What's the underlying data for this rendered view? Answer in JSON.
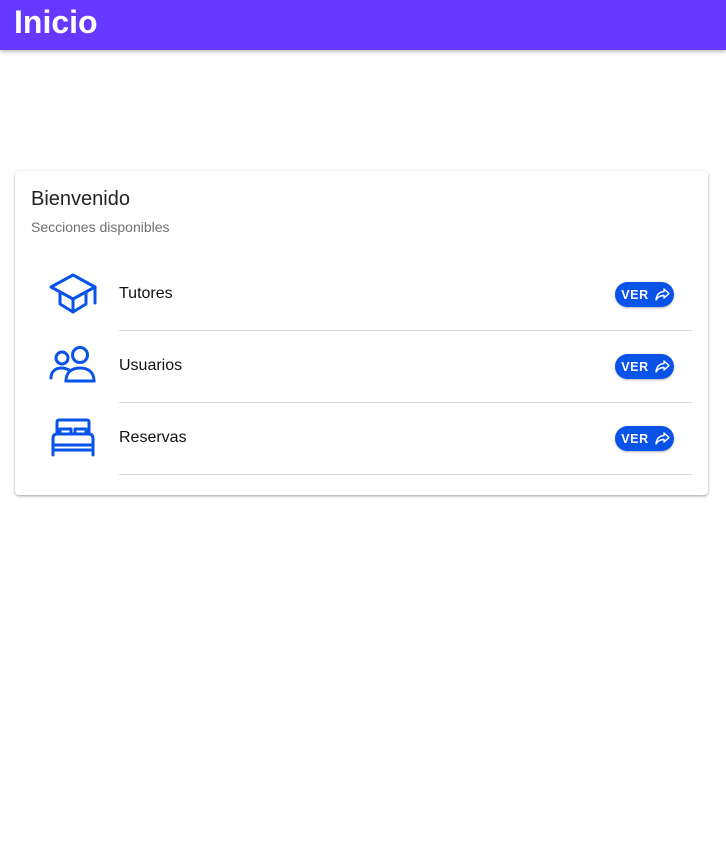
{
  "app_bar": {
    "title": "Inicio",
    "color": "#6738ff"
  },
  "card": {
    "title": "Bienvenido",
    "subtitle": "Secciones disponibles",
    "items": [
      {
        "label": "Tutores",
        "icon": "graduation-cap-icon",
        "button_label": "VER"
      },
      {
        "label": "Usuarios",
        "icon": "users-icon",
        "button_label": "VER"
      },
      {
        "label": "Reservas",
        "icon": "bed-icon",
        "button_label": "VER"
      }
    ]
  },
  "colors": {
    "accent": "#0a53e8",
    "icon": "#0a53e8"
  }
}
